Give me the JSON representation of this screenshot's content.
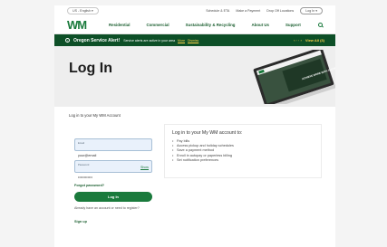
{
  "utility_bar": {
    "language": "US - English ▾",
    "links": [
      "Schedule & ETA",
      "Make a Payment",
      "Drop Off Locations"
    ],
    "login_label": "Log In ▾"
  },
  "nav": {
    "logo_text": "WM",
    "items": [
      "Residential",
      "Commercial",
      "Sustainability & Recycling",
      "About Us",
      "Support"
    ]
  },
  "alert": {
    "title": "Oregon Service Alert!",
    "message": "Service alerts are active in your area",
    "more_label": "More",
    "dismiss_label": "Dismiss",
    "view_all_label": "View All (3)",
    "nav_arrows": "‹ · · ›"
  },
  "hero": {
    "title": "Log In",
    "image_text": "ACHIEVE MORE WITH SUSTAINABLE SOLUTIONS"
  },
  "section_label": "Log in to your My WM Account",
  "form": {
    "email_label": "Email",
    "email_value": "your@email",
    "password_label": "Password",
    "password_value": "••••••••••••",
    "show_label": "Show",
    "forgot_label": "Forgot password?",
    "login_button": "Log In",
    "no_account_text": "Already have an account or need to register?",
    "signup_label": "Sign up"
  },
  "info": {
    "title": "Log in to your My WM account to:",
    "items": [
      "Pay bills",
      "Access pickup and holiday schedules",
      "Save a payment method",
      "Enroll in autopay or paperless billing",
      "Set notification preferences"
    ]
  },
  "colors": {
    "brand_green": "#1a7a3c",
    "alert_bg": "#0d4f27",
    "accent_yellow": "#ffb800"
  }
}
